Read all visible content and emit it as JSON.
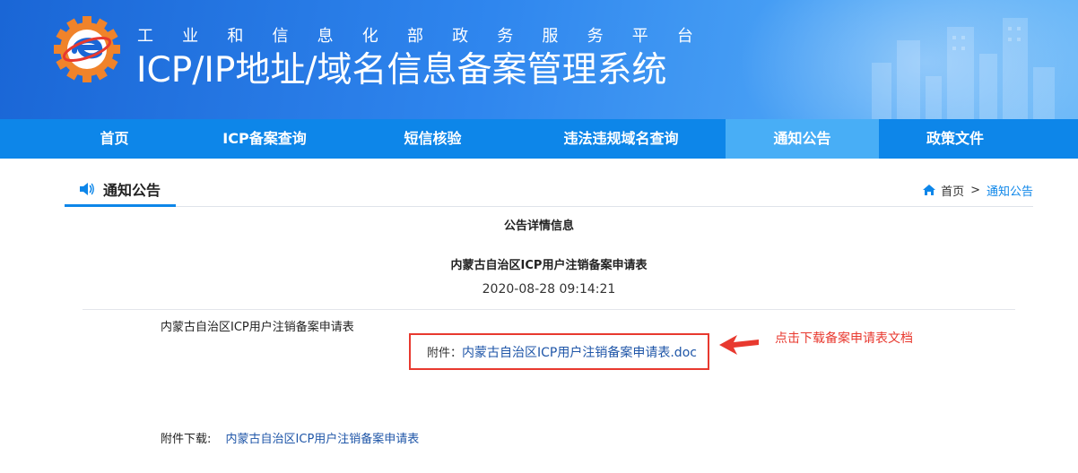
{
  "header": {
    "org_name_chars": [
      "工",
      "业",
      "和",
      "信",
      "息",
      "化",
      "部",
      "政",
      "务",
      "服",
      "务",
      "平",
      "台"
    ],
    "system_title": "ICP/IP地址/域名信息备案管理系统"
  },
  "nav": {
    "items": [
      {
        "label": "首页"
      },
      {
        "label": "ICP备案查询"
      },
      {
        "label": "短信核验"
      },
      {
        "label": "违法违规域名查询"
      },
      {
        "label": "通知公告",
        "active": true
      },
      {
        "label": "政策文件"
      }
    ]
  },
  "section": {
    "title": "通知公告",
    "icon": "speaker-icon"
  },
  "breadcrumb": {
    "home": "首页",
    "separator": ">",
    "current": "通知公告"
  },
  "detail": {
    "heading": "公告详情信息",
    "title": "内蒙古自治区ICP用户注销备案申请表",
    "date": "2020-08-28 09:14:21",
    "body": "内蒙古自治区ICP用户注销备案申请表",
    "attachment_label": "附件：",
    "attachment_file": "内蒙古自治区ICP用户注销备案申请表.doc",
    "annotation": "点击下载备案申请表文档",
    "download_label": "附件下载:",
    "download_link": "内蒙古自治区ICP用户注销备案申请表"
  },
  "colors": {
    "nav_bg": "#0d86e9",
    "nav_active": "#48aef6",
    "highlight_red": "#e8392f",
    "link_blue": "#1f56a8"
  }
}
